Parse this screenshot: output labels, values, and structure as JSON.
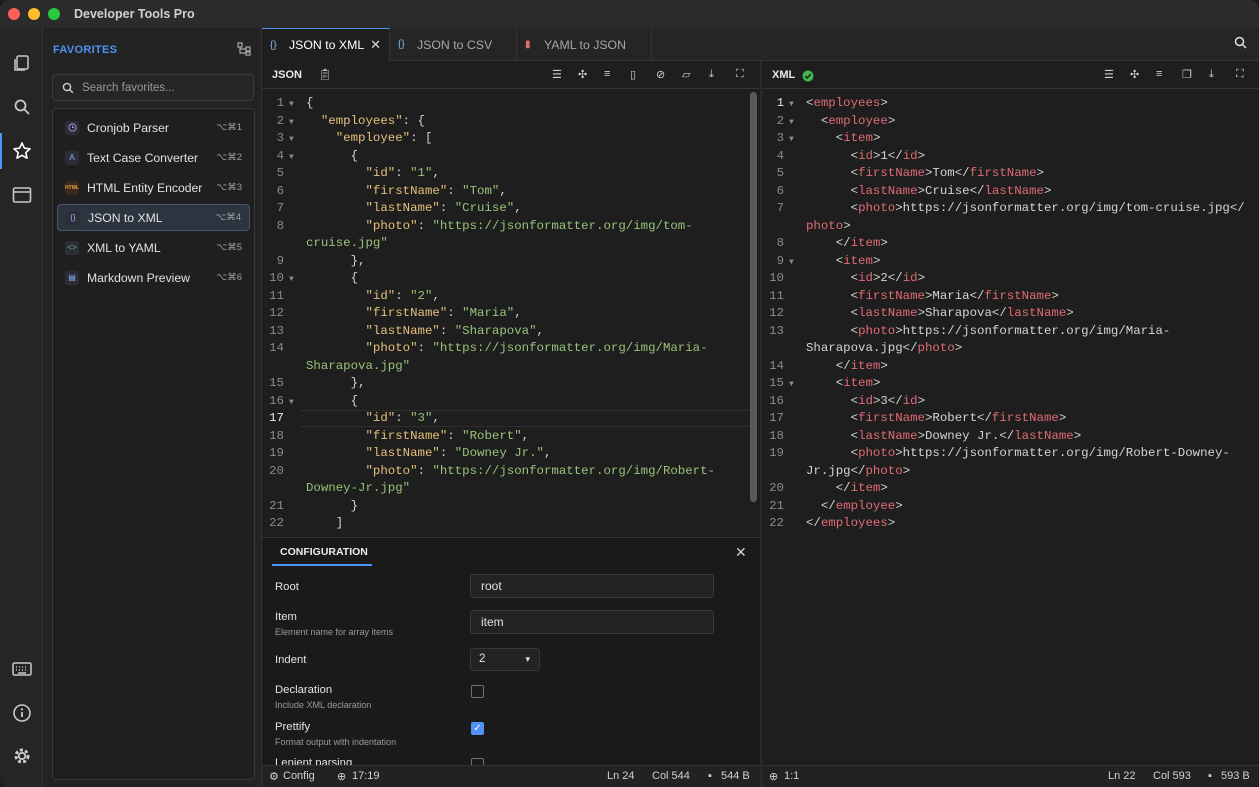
{
  "window": {
    "title": "Developer Tools Pro"
  },
  "rail": {
    "icons": [
      "book-icon",
      "search-icon",
      "star-icon",
      "window-icon",
      "moon-icon",
      "keyboard-icon",
      "info-icon",
      "gear-icon"
    ]
  },
  "sidebar": {
    "header": "FAVORITES",
    "search_placeholder": "Search favorites...",
    "items": [
      {
        "label": "Cronjob Parser",
        "shortcut": "⌥⌘1",
        "icon": "clock-icon"
      },
      {
        "label": "Text Case Converter",
        "shortcut": "⌥⌘2",
        "icon": "text-case-icon"
      },
      {
        "label": "HTML Entity Encoder",
        "shortcut": "⌥⌘3",
        "icon": "html-icon"
      },
      {
        "label": "JSON to XML",
        "shortcut": "⌥⌘4",
        "icon": "json-icon"
      },
      {
        "label": "XML to YAML",
        "shortcut": "⌥⌘5",
        "icon": "xml-icon"
      },
      {
        "label": "Markdown Preview",
        "shortcut": "⌥⌘6",
        "icon": "markdown-icon"
      }
    ]
  },
  "tabs": [
    {
      "label": "JSON to XML",
      "active": true
    },
    {
      "label": "JSON to CSV",
      "active": false
    },
    {
      "label": "YAML to JSON",
      "active": false
    }
  ],
  "input_pane": {
    "label": "JSON"
  },
  "output_pane": {
    "label": "XML",
    "status_color": "#3fb950"
  },
  "json_lines": [
    {
      "n": "1",
      "fold": true,
      "parts": [
        [
          "p",
          "{"
        ]
      ]
    },
    {
      "n": "2",
      "fold": true,
      "parts": [
        [
          "p",
          "  "
        ],
        [
          "k",
          "\"employees\""
        ],
        [
          "p",
          ": {"
        ]
      ]
    },
    {
      "n": "3",
      "fold": true,
      "parts": [
        [
          "p",
          "    "
        ],
        [
          "k",
          "\"employee\""
        ],
        [
          "p",
          ": ["
        ]
      ]
    },
    {
      "n": "4",
      "fold": true,
      "parts": [
        [
          "p",
          "      {"
        ]
      ]
    },
    {
      "n": "5",
      "fold": false,
      "parts": [
        [
          "p",
          "        "
        ],
        [
          "k",
          "\"id\""
        ],
        [
          "p",
          ": "
        ],
        [
          "s",
          "\"1\""
        ],
        [
          "p",
          ","
        ]
      ]
    },
    {
      "n": "6",
      "fold": false,
      "parts": [
        [
          "p",
          "        "
        ],
        [
          "k",
          "\"firstName\""
        ],
        [
          "p",
          ": "
        ],
        [
          "s",
          "\"Tom\""
        ],
        [
          "p",
          ","
        ]
      ]
    },
    {
      "n": "7",
      "fold": false,
      "parts": [
        [
          "p",
          "        "
        ],
        [
          "k",
          "\"lastName\""
        ],
        [
          "p",
          ": "
        ],
        [
          "s",
          "\"Cruise\""
        ],
        [
          "p",
          ","
        ]
      ]
    },
    {
      "n": "8",
      "fold": false,
      "parts": [
        [
          "p",
          "        "
        ],
        [
          "k",
          "\"photo\""
        ],
        [
          "p",
          ": "
        ],
        [
          "s",
          "\"https://jsonformatter.org/img/tom-"
        ]
      ]
    },
    {
      "n": "",
      "fold": false,
      "parts": [
        [
          "s",
          "cruise.jpg\""
        ]
      ]
    },
    {
      "n": "9",
      "fold": false,
      "parts": [
        [
          "p",
          "      },"
        ]
      ]
    },
    {
      "n": "10",
      "fold": true,
      "parts": [
        [
          "p",
          "      {"
        ]
      ]
    },
    {
      "n": "11",
      "fold": false,
      "parts": [
        [
          "p",
          "        "
        ],
        [
          "k",
          "\"id\""
        ],
        [
          "p",
          ": "
        ],
        [
          "s",
          "\"2\""
        ],
        [
          "p",
          ","
        ]
      ]
    },
    {
      "n": "12",
      "fold": false,
      "parts": [
        [
          "p",
          "        "
        ],
        [
          "k",
          "\"firstName\""
        ],
        [
          "p",
          ": "
        ],
        [
          "s",
          "\"Maria\""
        ],
        [
          "p",
          ","
        ]
      ]
    },
    {
      "n": "13",
      "fold": false,
      "parts": [
        [
          "p",
          "        "
        ],
        [
          "k",
          "\"lastName\""
        ],
        [
          "p",
          ": "
        ],
        [
          "s",
          "\"Sharapova\""
        ],
        [
          "p",
          ","
        ]
      ]
    },
    {
      "n": "14",
      "fold": false,
      "parts": [
        [
          "p",
          "        "
        ],
        [
          "k",
          "\"photo\""
        ],
        [
          "p",
          ": "
        ],
        [
          "s",
          "\"https://jsonformatter.org/img/Maria-"
        ]
      ]
    },
    {
      "n": "",
      "fold": false,
      "parts": [
        [
          "s",
          "Sharapova.jpg\""
        ]
      ]
    },
    {
      "n": "15",
      "fold": false,
      "parts": [
        [
          "p",
          "      },"
        ]
      ]
    },
    {
      "n": "16",
      "fold": true,
      "parts": [
        [
          "p",
          "      {"
        ]
      ]
    },
    {
      "n": "17",
      "fold": false,
      "parts": [
        [
          "p",
          "        "
        ],
        [
          "k",
          "\"id\""
        ],
        [
          "p",
          ": "
        ],
        [
          "s",
          "\"3\""
        ],
        [
          "p",
          ","
        ]
      ]
    },
    {
      "n": "18",
      "fold": false,
      "parts": [
        [
          "p",
          "        "
        ],
        [
          "k",
          "\"firstName\""
        ],
        [
          "p",
          ": "
        ],
        [
          "s",
          "\"Robert\""
        ],
        [
          "p",
          ","
        ]
      ]
    },
    {
      "n": "19",
      "fold": false,
      "parts": [
        [
          "p",
          "        "
        ],
        [
          "k",
          "\"lastName\""
        ],
        [
          "p",
          ": "
        ],
        [
          "s",
          "\"Downey Jr.\""
        ],
        [
          "p",
          ","
        ]
      ]
    },
    {
      "n": "20",
      "fold": false,
      "parts": [
        [
          "p",
          "        "
        ],
        [
          "k",
          "\"photo\""
        ],
        [
          "p",
          ": "
        ],
        [
          "s",
          "\"https://jsonformatter.org/img/Robert-"
        ]
      ]
    },
    {
      "n": "",
      "fold": false,
      "parts": [
        [
          "s",
          "Downey-Jr.jpg\""
        ]
      ]
    },
    {
      "n": "21",
      "fold": false,
      "parts": [
        [
          "p",
          "      }"
        ]
      ]
    },
    {
      "n": "22",
      "fold": false,
      "parts": [
        [
          "p",
          "    ]"
        ]
      ]
    }
  ],
  "xml_lines": [
    {
      "n": "1",
      "fold": true,
      "parts": [
        [
          "p",
          "<"
        ],
        [
          "t",
          "employees"
        ],
        [
          "p",
          ">"
        ]
      ]
    },
    {
      "n": "2",
      "fold": true,
      "parts": [
        [
          "p",
          "  <"
        ],
        [
          "t",
          "employee"
        ],
        [
          "p",
          ">"
        ]
      ]
    },
    {
      "n": "3",
      "fold": true,
      "parts": [
        [
          "p",
          "    <"
        ],
        [
          "t",
          "item"
        ],
        [
          "p",
          ">"
        ]
      ]
    },
    {
      "n": "4",
      "fold": false,
      "parts": [
        [
          "p",
          "      <"
        ],
        [
          "t",
          "id"
        ],
        [
          "p",
          ">1</"
        ],
        [
          "t",
          "id"
        ],
        [
          "p",
          ">"
        ]
      ]
    },
    {
      "n": "5",
      "fold": false,
      "parts": [
        [
          "p",
          "      <"
        ],
        [
          "t",
          "firstName"
        ],
        [
          "p",
          ">Tom</"
        ],
        [
          "t",
          "firstName"
        ],
        [
          "p",
          ">"
        ]
      ]
    },
    {
      "n": "6",
      "fold": false,
      "parts": [
        [
          "p",
          "      <"
        ],
        [
          "t",
          "lastName"
        ],
        [
          "p",
          ">Cruise</"
        ],
        [
          "t",
          "lastName"
        ],
        [
          "p",
          ">"
        ]
      ]
    },
    {
      "n": "7",
      "fold": false,
      "parts": [
        [
          "p",
          "      <"
        ],
        [
          "t",
          "photo"
        ],
        [
          "p",
          ">https://jsonformatter.org/img/tom-cruise.jpg</"
        ]
      ]
    },
    {
      "n": "",
      "fold": false,
      "parts": [
        [
          "t",
          "photo"
        ],
        [
          "p",
          ">"
        ]
      ]
    },
    {
      "n": "8",
      "fold": false,
      "parts": [
        [
          "p",
          "    </"
        ],
        [
          "t",
          "item"
        ],
        [
          "p",
          ">"
        ]
      ]
    },
    {
      "n": "9",
      "fold": true,
      "parts": [
        [
          "p",
          "    <"
        ],
        [
          "t",
          "item"
        ],
        [
          "p",
          ">"
        ]
      ]
    },
    {
      "n": "10",
      "fold": false,
      "parts": [
        [
          "p",
          "      <"
        ],
        [
          "t",
          "id"
        ],
        [
          "p",
          ">2</"
        ],
        [
          "t",
          "id"
        ],
        [
          "p",
          ">"
        ]
      ]
    },
    {
      "n": "11",
      "fold": false,
      "parts": [
        [
          "p",
          "      <"
        ],
        [
          "t",
          "firstName"
        ],
        [
          "p",
          ">Maria</"
        ],
        [
          "t",
          "firstName"
        ],
        [
          "p",
          ">"
        ]
      ]
    },
    {
      "n": "12",
      "fold": false,
      "parts": [
        [
          "p",
          "      <"
        ],
        [
          "t",
          "lastName"
        ],
        [
          "p",
          ">Sharapova</"
        ],
        [
          "t",
          "lastName"
        ],
        [
          "p",
          ">"
        ]
      ]
    },
    {
      "n": "13",
      "fold": false,
      "parts": [
        [
          "p",
          "      <"
        ],
        [
          "t",
          "photo"
        ],
        [
          "p",
          ">https://jsonformatter.org/img/Maria-"
        ]
      ]
    },
    {
      "n": "",
      "fold": false,
      "parts": [
        [
          "p",
          "Sharapova.jpg</"
        ],
        [
          "t",
          "photo"
        ],
        [
          "p",
          ">"
        ]
      ]
    },
    {
      "n": "14",
      "fold": false,
      "parts": [
        [
          "p",
          "    </"
        ],
        [
          "t",
          "item"
        ],
        [
          "p",
          ">"
        ]
      ]
    },
    {
      "n": "15",
      "fold": true,
      "parts": [
        [
          "p",
          "    <"
        ],
        [
          "t",
          "item"
        ],
        [
          "p",
          ">"
        ]
      ]
    },
    {
      "n": "16",
      "fold": false,
      "parts": [
        [
          "p",
          "      <"
        ],
        [
          "t",
          "id"
        ],
        [
          "p",
          ">3</"
        ],
        [
          "t",
          "id"
        ],
        [
          "p",
          ">"
        ]
      ]
    },
    {
      "n": "17",
      "fold": false,
      "parts": [
        [
          "p",
          "      <"
        ],
        [
          "t",
          "firstName"
        ],
        [
          "p",
          ">Robert</"
        ],
        [
          "t",
          "firstName"
        ],
        [
          "p",
          ">"
        ]
      ]
    },
    {
      "n": "18",
      "fold": false,
      "parts": [
        [
          "p",
          "      <"
        ],
        [
          "t",
          "lastName"
        ],
        [
          "p",
          ">Downey Jr.</"
        ],
        [
          "t",
          "lastName"
        ],
        [
          "p",
          ">"
        ]
      ]
    },
    {
      "n": "19",
      "fold": false,
      "parts": [
        [
          "p",
          "      <"
        ],
        [
          "t",
          "photo"
        ],
        [
          "p",
          ">https://jsonformatter.org/img/Robert-Downey-"
        ]
      ]
    },
    {
      "n": "",
      "fold": false,
      "parts": [
        [
          "p",
          "Jr.jpg</"
        ],
        [
          "t",
          "photo"
        ],
        [
          "p",
          ">"
        ]
      ]
    },
    {
      "n": "20",
      "fold": false,
      "parts": [
        [
          "p",
          "    </"
        ],
        [
          "t",
          "item"
        ],
        [
          "p",
          ">"
        ]
      ]
    },
    {
      "n": "21",
      "fold": false,
      "parts": [
        [
          "p",
          "  </"
        ],
        [
          "t",
          "employee"
        ],
        [
          "p",
          ">"
        ]
      ]
    },
    {
      "n": "22",
      "fold": false,
      "parts": [
        [
          "p",
          "</"
        ],
        [
          "t",
          "employees"
        ],
        [
          "p",
          ">"
        ]
      ]
    }
  ],
  "config": {
    "tab_label": "CONFIGURATION",
    "root_label": "Root",
    "root_value": "root",
    "item_label": "Item",
    "item_sub": "Element name for array items",
    "item_value": "item",
    "indent_label": "Indent",
    "indent_value": "2",
    "declaration_label": "Declaration",
    "declaration_sub": "Include XML declaration",
    "declaration_checked": false,
    "prettify_label": "Prettify",
    "prettify_sub": "Format output with indentation",
    "prettify_checked": true,
    "lenient_label": "Lenient parsing"
  },
  "status_left": {
    "config": "Config",
    "time": "17:19",
    "line": "Ln 24",
    "col": "Col 544",
    "size": "544 B"
  },
  "status_right": {
    "pos": "1:1",
    "line": "Ln 22",
    "col": "Col 593",
    "size": "593 B"
  },
  "colors": {
    "accent": "#4e93f5",
    "tag": "#e06c75",
    "key": "#e5c07b",
    "string": "#98c379"
  }
}
